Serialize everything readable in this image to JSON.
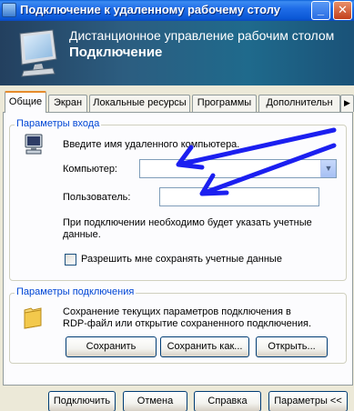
{
  "window": {
    "title": "Подключение к удаленному рабочему столу",
    "minimize_glyph": "_",
    "close_glyph": "✕"
  },
  "banner": {
    "line1": "Дистанционное управление рабочим столом",
    "line2": "Подключение"
  },
  "tabs": [
    {
      "label": "Общие",
      "active": true
    },
    {
      "label": "Экран",
      "active": false
    },
    {
      "label": "Локальные ресурсы",
      "active": false
    },
    {
      "label": "Программы",
      "active": false
    },
    {
      "label": "Дополнительн",
      "active": false
    }
  ],
  "login_group": {
    "legend": "Параметры входа",
    "prompt": "Введите имя удаленного компьютера.",
    "computer_label": "Компьютер:",
    "computer_value": "",
    "user_label": "Пользователь:",
    "user_value": "",
    "note": "При подключении необходимо будет указать учетные данные.",
    "note_line1": "При подключении необходимо будет указать учетные",
    "note_line2": "данные.",
    "save_credentials_label": "Разрешить мне сохранять учетные данные",
    "save_credentials_checked": false
  },
  "connection_group": {
    "legend": "Параметры подключения",
    "desc_line1": "Сохранение текущих параметров подключения в",
    "desc_line2": "RDP-файл или открытие сохраненного подключения.",
    "save_label": "Сохранить",
    "save_as_label": "Сохранить как...",
    "open_label": "Открыть..."
  },
  "footer": {
    "connect_label": "Подключить",
    "cancel_label": "Отмена",
    "help_label": "Справка",
    "options_label": "Параметры <<"
  },
  "colors": {
    "arrow": "#1b1ff0",
    "legend_text": "#0046d5",
    "active_tab_highlight": "#e68b2c"
  }
}
